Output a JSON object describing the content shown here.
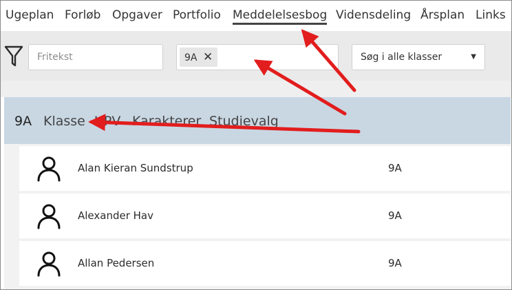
{
  "nav": {
    "items": [
      "Ugeplan",
      "Forløb",
      "Opgaver",
      "Portfolio",
      "Meddelelsesbog",
      "Vidensdeling",
      "Årsplan",
      "Links"
    ],
    "active": "Meddelelsesbog"
  },
  "filters": {
    "filter_icon": "funnel-icon",
    "search_placeholder": "Fritekst",
    "selected_class_chip": "9A",
    "chip_remove": "✕",
    "scope_select": "Søg i alle klasser",
    "dropdown_icon": "triangle-down-icon"
  },
  "class_header": {
    "code": "9A",
    "tabs": [
      "Klasse",
      "UPV",
      "Karakterer",
      "Studievalg"
    ]
  },
  "students": [
    {
      "name": "Alan Kieran Sundstrup",
      "class": "9A",
      "icon": "person-icon"
    },
    {
      "name": "Alexander Hav",
      "class": "9A",
      "icon": "person-icon"
    },
    {
      "name": "Allan Pedersen",
      "class": "9A",
      "icon": "person-icon"
    }
  ],
  "annotation": {
    "arrow_color": "#e21d1d"
  }
}
